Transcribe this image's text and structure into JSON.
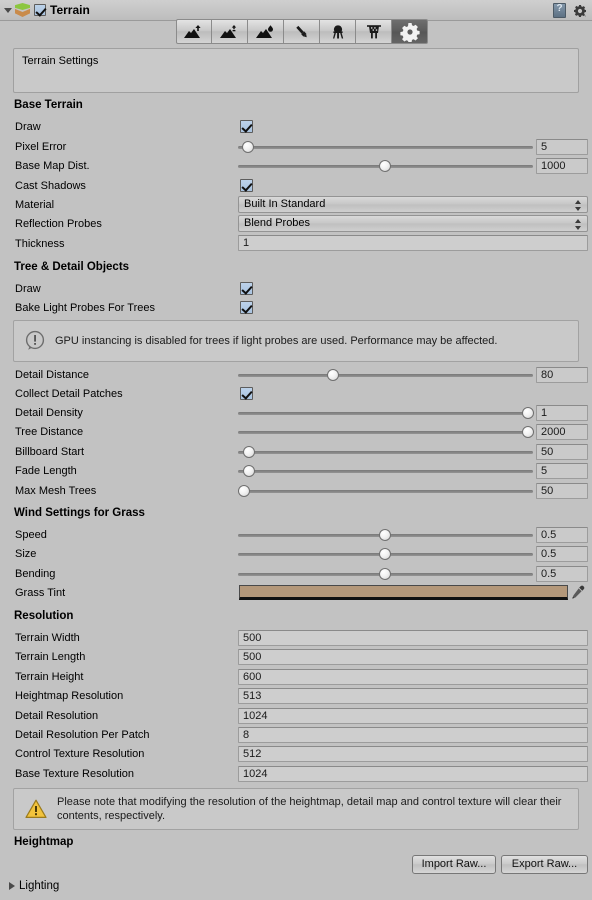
{
  "header": {
    "title": "Terrain",
    "enabled_checkbox": true,
    "foldout_open": true,
    "terrain_icon": "terrain-icon",
    "help_icon": "help-book-icon",
    "settings_icon": "gear-icon"
  },
  "toolbar": {
    "tools": [
      {
        "name": "raise-lower-terrain-tool",
        "icon": "mountain-up-arrow-icon",
        "selected": false
      },
      {
        "name": "paint-height-tool",
        "icon": "mountain-height-icon",
        "selected": false
      },
      {
        "name": "smooth-height-tool",
        "icon": "mountain-smooth-icon",
        "selected": false
      },
      {
        "name": "paint-texture-tool",
        "icon": "paintbrush-icon",
        "selected": false
      },
      {
        "name": "place-trees-tool",
        "icon": "tree-icon",
        "selected": false
      },
      {
        "name": "paint-details-tool",
        "icon": "grass-detail-icon",
        "selected": false
      },
      {
        "name": "terrain-settings-tool",
        "icon": "gear-icon",
        "selected": true
      }
    ]
  },
  "description": {
    "text": "Terrain Settings"
  },
  "sections": {
    "base_terrain": {
      "title": "Base Terrain",
      "rows": [
        {
          "label": "Draw",
          "type": "checkbox",
          "value": true
        },
        {
          "label": "Pixel Error",
          "type": "slider",
          "value": "5",
          "fill": 0.035
        },
        {
          "label": "Base Map Dist.",
          "type": "slider",
          "value": "1000",
          "fill": 0.5
        },
        {
          "label": "Cast Shadows",
          "type": "checkbox",
          "value": true
        },
        {
          "label": "Material",
          "type": "popup",
          "value": "Built In Standard"
        },
        {
          "label": "Reflection Probes",
          "type": "popup",
          "value": "Blend Probes"
        },
        {
          "label": "Thickness",
          "type": "text",
          "value": "1"
        }
      ]
    },
    "tree_detail": {
      "title": "Tree & Detail Objects",
      "rows": [
        {
          "label": "Draw",
          "type": "checkbox",
          "value": true
        },
        {
          "label": "Bake Light Probes For Trees",
          "type": "checkbox",
          "value": true
        }
      ],
      "info": {
        "icon": "info-circle-icon",
        "text": "GPU instancing is disabled for trees if light probes are used. Performance may be affected."
      },
      "rows2": [
        {
          "label": "Detail Distance",
          "type": "slider",
          "value": "80",
          "fill": 0.32
        },
        {
          "label": "Collect Detail Patches",
          "type": "checkbox",
          "value": true
        },
        {
          "label": "Detail Density",
          "type": "slider",
          "value": "1",
          "fill": 1.0
        },
        {
          "label": "Tree Distance",
          "type": "slider",
          "value": "2000",
          "fill": 1.0
        },
        {
          "label": "Billboard Start",
          "type": "slider",
          "value": "50",
          "fill": 0.035
        },
        {
          "label": "Fade Length",
          "type": "slider",
          "value": "5",
          "fill": 0.035
        },
        {
          "label": "Max Mesh Trees",
          "type": "slider",
          "value": "50",
          "fill": 0.018
        }
      ]
    },
    "wind": {
      "title": "Wind Settings for Grass",
      "rows": [
        {
          "label": "Speed",
          "type": "slider",
          "value": "0.5",
          "fill": 0.5
        },
        {
          "label": "Size",
          "type": "slider",
          "value": "0.5",
          "fill": 0.5
        },
        {
          "label": "Bending",
          "type": "slider",
          "value": "0.5",
          "fill": 0.5
        },
        {
          "label": "Grass Tint",
          "type": "color",
          "value": "#b4987a"
        }
      ]
    },
    "resolution": {
      "title": "Resolution",
      "rows": [
        {
          "label": "Terrain Width",
          "value": "500"
        },
        {
          "label": "Terrain Length",
          "value": "500"
        },
        {
          "label": "Terrain Height",
          "value": "600"
        },
        {
          "label": "Heightmap Resolution",
          "value": "513"
        },
        {
          "label": "Detail Resolution",
          "value": "1024"
        },
        {
          "label": "Detail Resolution Per Patch",
          "value": "8"
        },
        {
          "label": "Control Texture Resolution",
          "value": "512"
        },
        {
          "label": "Base Texture Resolution",
          "value": "1024"
        }
      ],
      "warning": {
        "icon": "warning-triangle-icon",
        "text": "Please note that modifying the resolution of the heightmap, detail map and control texture will clear their contents, respectively."
      }
    },
    "heightmap": {
      "title": "Heightmap",
      "import_button": "Import Raw...",
      "export_button": "Export Raw..."
    },
    "lighting": {
      "title": "Lighting",
      "foldout_open": false
    }
  },
  "colors": {
    "background": "#c2c2c2",
    "grass_tint": "#b4987a",
    "checkbox_fill": "#aac4e1",
    "warning_yellow": "#f0c040"
  }
}
